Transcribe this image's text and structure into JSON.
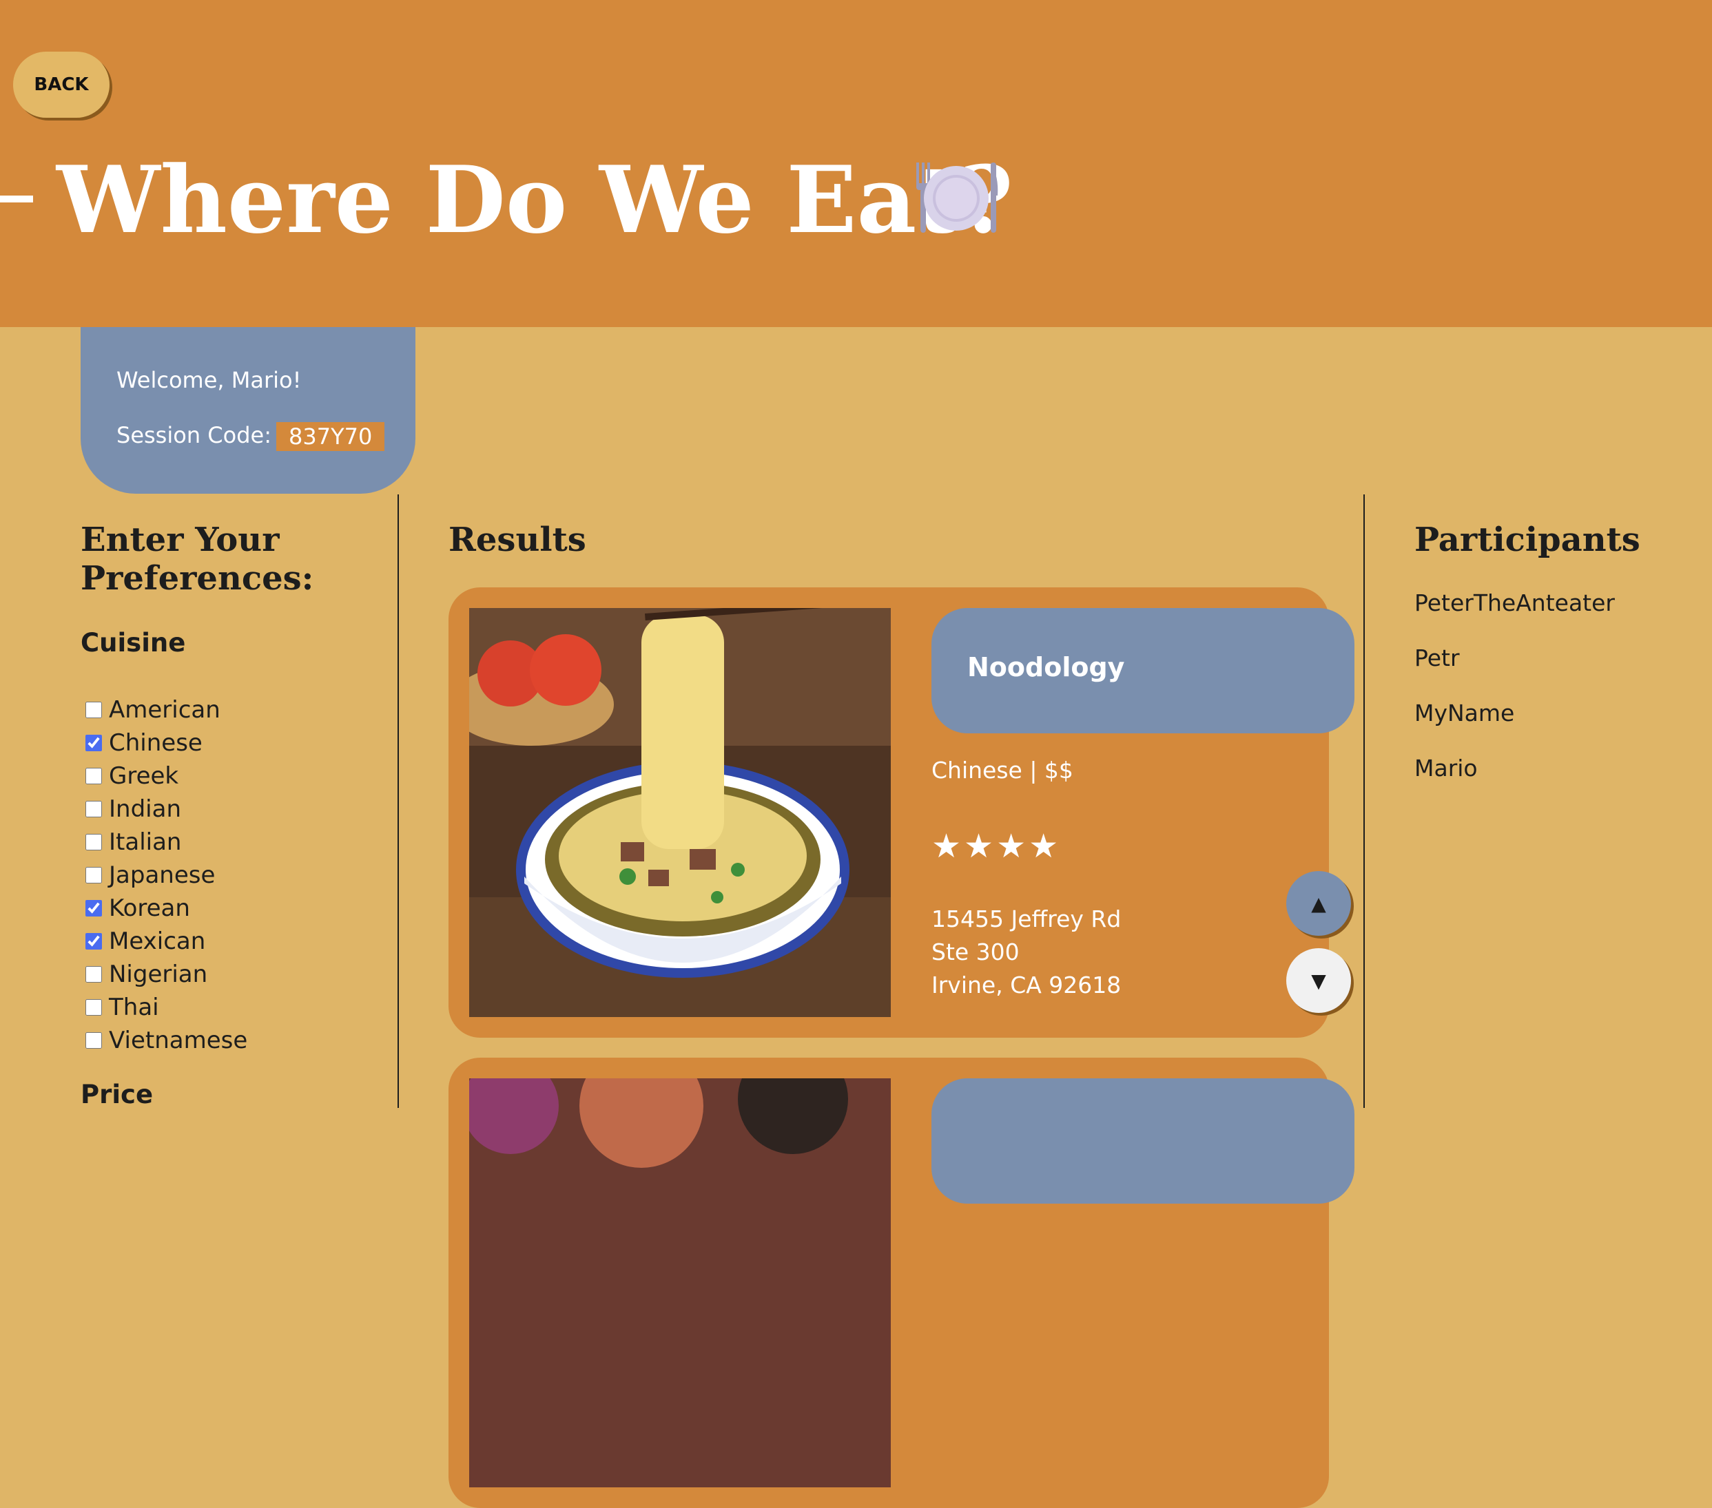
{
  "header": {
    "back_label": "BACK",
    "title": "Where Do We Eat?",
    "title_icon": "plate-with-cutlery-icon"
  },
  "welcome": {
    "greeting": "Welcome, Mario!",
    "session_label": "Session Code:",
    "session_code": "837Y70"
  },
  "preferences": {
    "heading_line1": "Enter Your",
    "heading_line2": "Preferences:",
    "cuisine_label": "Cuisine",
    "cuisines": [
      {
        "label": "American",
        "checked": false
      },
      {
        "label": "Chinese",
        "checked": true
      },
      {
        "label": "Greek",
        "checked": false
      },
      {
        "label": "Indian",
        "checked": false
      },
      {
        "label": "Italian",
        "checked": false
      },
      {
        "label": "Japanese",
        "checked": false
      },
      {
        "label": "Korean",
        "checked": true
      },
      {
        "label": "Mexican",
        "checked": true
      },
      {
        "label": "Nigerian",
        "checked": false
      },
      {
        "label": "Thai",
        "checked": false
      },
      {
        "label": "Vietnamese",
        "checked": false
      }
    ],
    "price_label": "Price"
  },
  "results": {
    "heading": "Results",
    "items": [
      {
        "name": "Noodology",
        "meta": "Chinese | $$",
        "stars": "★★★★",
        "rating": 4,
        "address_line1": "15455 Jeffrey Rd",
        "address_line2": "Ste 300",
        "address_line3": "Irvine, CA 92618"
      }
    ],
    "up_icon": "▲",
    "down_icon": "▼"
  },
  "participants": {
    "heading": "Participants",
    "names": [
      "PeterTheAnteater",
      "Petr",
      "MyName",
      "Mario"
    ]
  },
  "colors": {
    "header_bg": "#d4893b",
    "page_bg": "#dfb567",
    "card_blue": "#7a8fae",
    "accent_orange": "#d4893b"
  }
}
